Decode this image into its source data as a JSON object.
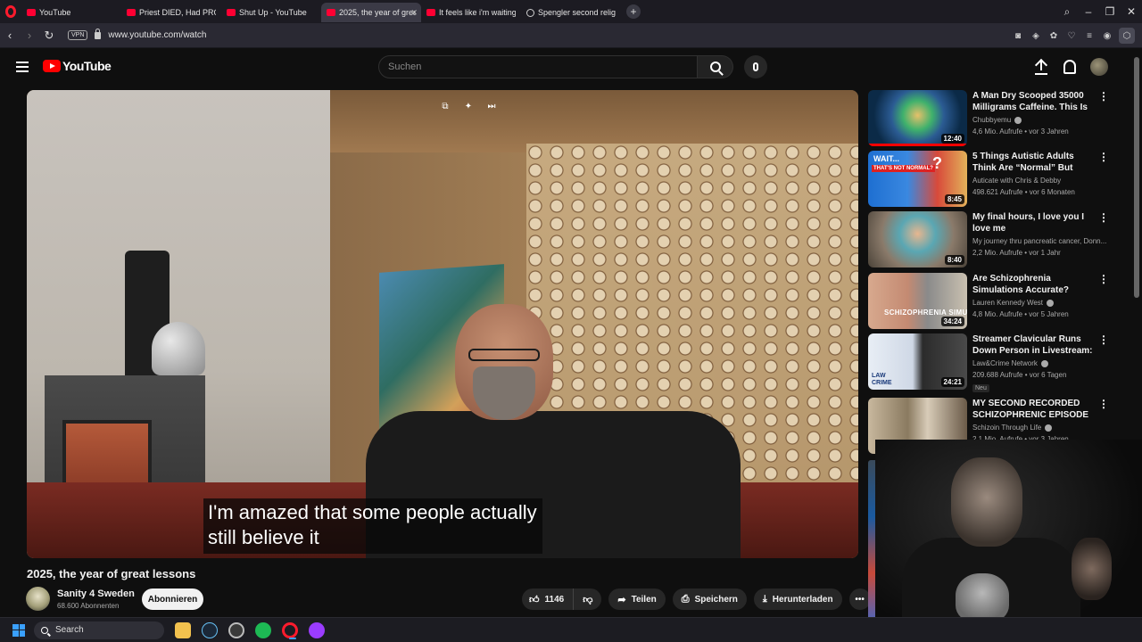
{
  "browser": {
    "tabs": [
      {
        "label": "YouTube",
        "active": false,
        "icon": "youtube-favicon"
      },
      {
        "label": "Priest DIED, Had PROFOUN",
        "active": false,
        "icon": "youtube-favicon"
      },
      {
        "label": "Shut Up - YouTube",
        "active": false,
        "icon": "youtube-favicon"
      },
      {
        "label": "2025, the year of great les",
        "active": true,
        "icon": "youtube-favicon"
      },
      {
        "label": "It feels like i'm waiting to",
        "active": false,
        "icon": "youtube-favicon"
      },
      {
        "label": "Spengler second religious",
        "active": false,
        "icon": "globe-icon"
      }
    ],
    "vpn_label": "VPN",
    "url": "www.youtube.com/watch"
  },
  "masthead": {
    "logo_text": "YouTube",
    "search_placeholder": "Suchen"
  },
  "video": {
    "caption_line1": "I'm amazed that some people actually",
    "caption_line2": "still believe it",
    "title": "2025, the year of great lessons"
  },
  "channel": {
    "name": "Sanity 4 Sweden",
    "subscribers": "68.600 Abonnenten",
    "subscribe_label": "Abonnieren"
  },
  "actions": {
    "likes": "1146",
    "share": "Teilen",
    "save": "Speichern",
    "download": "Herunterladen"
  },
  "recommendations": [
    {
      "title": "A Man Dry Scooped 35000 Milligrams Caffeine. This Is ...",
      "channel": "Chubbyemu",
      "verified": true,
      "meta": "4,6 Mio. Aufrufe • vor 3 Jahren",
      "duration": "12:40",
      "watched_fraction": 1.0,
      "badge": ""
    },
    {
      "title": "5 Things Autistic Adults Think Are “Normal” But Actually Aren't",
      "channel": "Auticate with Chris & Debby",
      "verified": false,
      "meta": "498.621 Aufrufe • vor 6 Monaten",
      "duration": "8:45",
      "watched_fraction": 0,
      "badge": ""
    },
    {
      "title": "My final hours, I love you I love me",
      "channel": "My journey thru pancreatic cancer, Donn...",
      "verified": false,
      "meta": "2,2 Mio. Aufrufe • vor 1 Jahr",
      "duration": "8:40",
      "watched_fraction": 0,
      "badge": ""
    },
    {
      "title": "Are Schizophrenia Simulations Accurate?",
      "channel": "Lauren Kennedy West",
      "verified": true,
      "meta": "4,8 Mio. Aufrufe • vor 5 Jahren",
      "duration": "34:24",
      "watched_fraction": 0,
      "badge": ""
    },
    {
      "title": "Streamer Clavicular Runs Down Person in Livestream: Police",
      "channel": "Law&Crime Network",
      "verified": true,
      "meta": "209.688 Aufrufe • vor 6 Tagen",
      "duration": "24:21",
      "watched_fraction": 0,
      "badge": "Neu"
    },
    {
      "title": "MY SECOND RECORDED SCHIZOPHRENIC EPISODE",
      "channel": "Schizoin Through Life",
      "verified": true,
      "meta": "2,1 Mio. Aufrufe • vor 3 Jahren",
      "duration": "",
      "watched_fraction": 0,
      "badge": ""
    }
  ],
  "thumb_overlays": {
    "rec2_text": "WAIT...",
    "rec2_sub": "THAT'S NOT NORMAL?",
    "rec4_text": "SCHIZOPHRENIA SIMULATIC",
    "rec5_text": "LAW CRIME"
  },
  "taskbar": {
    "search_label": "Search"
  },
  "colors": {
    "yt_red": "#ff0000",
    "background": "#0f0f0f",
    "pill": "#272727"
  }
}
